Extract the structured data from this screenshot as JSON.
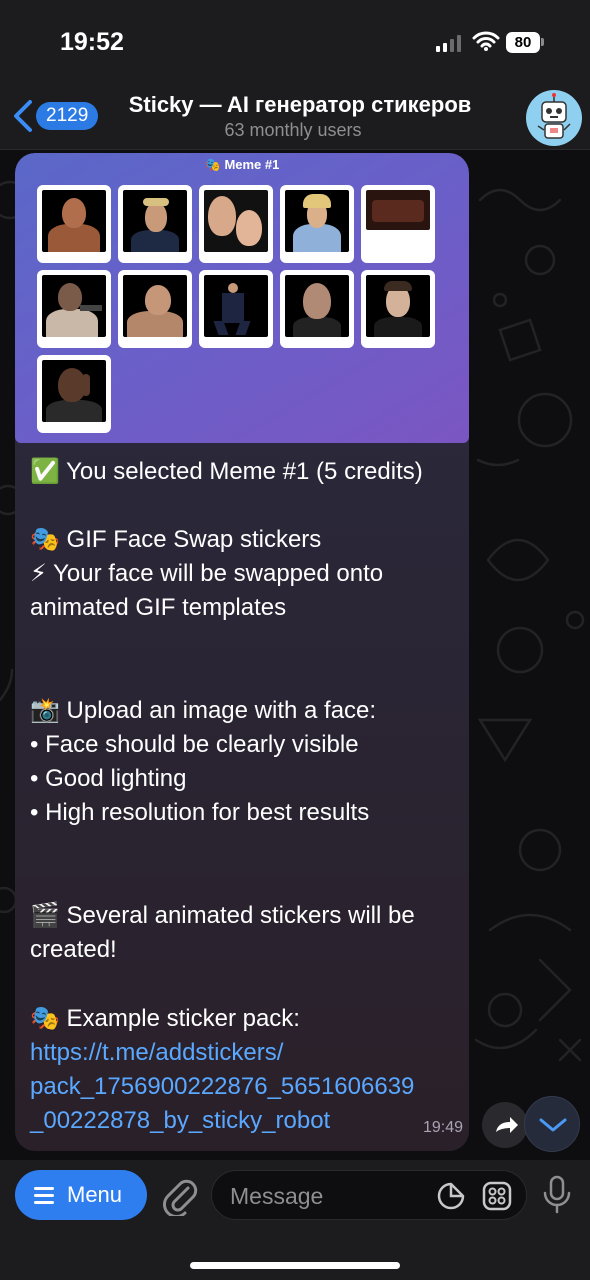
{
  "status_bar": {
    "time": "19:52",
    "battery": "80"
  },
  "header": {
    "back_badge": "2129",
    "title": "Sticky — AI генератор стикеров",
    "subtitle": "63 monthly users"
  },
  "message": {
    "media_title": "🎭 Meme #1",
    "lines": [
      "✅ You selected Meme #1 (5 credits)",
      "🎭 GIF Face Swap stickers",
      "⚡ Your face will be swapped onto",
      "animated GIF templates",
      "📸 Upload an image with a face:",
      "• Face should be clearly visible",
      "• Good lighting",
      "• High resolution for best results",
      "🎬 Several animated stickers will be",
      "created!",
      "🎭 Example sticker pack:"
    ],
    "link_lines": [
      "https://t.me/addstickers/",
      "pack_1756900222876_5651606639",
      "_00222878_by_sticky_robot"
    ],
    "time": "19:49"
  },
  "input_bar": {
    "menu_label": "Menu",
    "placeholder": "Message"
  },
  "colors": {
    "accent": "#2f7ef0",
    "link": "#5aa8ff",
    "badge": "#2c7be5"
  }
}
